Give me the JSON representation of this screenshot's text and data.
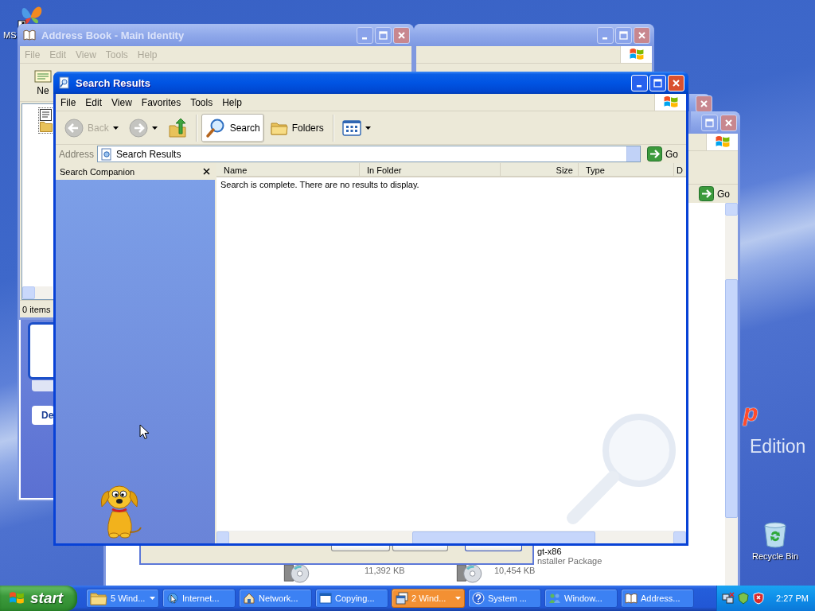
{
  "desktop": {
    "icons": [
      {
        "label": "MS"
      },
      {
        "label": "Recycle Bin"
      }
    ],
    "wallpaper_text": [
      {
        "kind": "logo",
        "text": "p"
      },
      {
        "kind": "caption",
        "text": "Edition"
      }
    ]
  },
  "explorer_behind": {
    "go": "Go",
    "files": [
      {
        "size": "11,392 KB"
      },
      {
        "name": "gt-x86",
        "type": "nstaller Package",
        "size": "10,454 KB"
      }
    ]
  },
  "address_book": {
    "title": "Address Book - Main Identity",
    "active": false,
    "menu": [
      {
        "label": "File",
        "disabled": true
      },
      {
        "label": "Edit",
        "disabled": true
      },
      {
        "label": "View",
        "disabled": true
      },
      {
        "label": "Tools",
        "disabled": true
      },
      {
        "label": "Help",
        "disabled": true
      }
    ],
    "toolbar": [
      {
        "label": "Ne"
      }
    ],
    "status": "0 items"
  },
  "wizard": {
    "button": "De"
  },
  "search_window": {
    "title": "Search Results",
    "active": true,
    "menu": [
      {
        "label": "File",
        "disabled": false
      },
      {
        "label": "Edit",
        "disabled": false
      },
      {
        "label": "View",
        "disabled": false
      },
      {
        "label": "Favorites",
        "disabled": false
      },
      {
        "label": "Tools",
        "disabled": false
      },
      {
        "label": "Help",
        "disabled": false
      }
    ],
    "toolbar": [
      {
        "kind": "back",
        "label": "Back",
        "disabled": true
      },
      {
        "kind": "forward",
        "disabled": true
      },
      {
        "kind": "up"
      },
      {
        "kind": "search",
        "label": "Search",
        "selected": true
      },
      {
        "kind": "folders",
        "label": "Folders",
        "selected": false
      },
      {
        "kind": "views"
      }
    ],
    "address": {
      "label": "Address",
      "value": "Search Results",
      "go": "Go"
    },
    "companion": {
      "title": "Search Companion"
    },
    "columns": [
      "Name",
      "In Folder",
      "Size",
      "Type",
      "D"
    ],
    "message": "Search is complete. There are no results to display."
  },
  "taskbar": {
    "start": "start",
    "items": [
      {
        "label": "5 Wind...",
        "grouped": true,
        "flashing": false
      },
      {
        "label": "Internet...",
        "grouped": false,
        "flashing": false
      },
      {
        "label": "Network...",
        "grouped": false,
        "flashing": false
      },
      {
        "label": "Copying...",
        "grouped": false,
        "flashing": false
      },
      {
        "label": "2 Wind...",
        "grouped": true,
        "flashing": true
      },
      {
        "label": "System ...",
        "grouped": false,
        "flashing": false
      },
      {
        "label": "Window...",
        "grouped": false,
        "flashing": false
      },
      {
        "label": "Address...",
        "grouped": false,
        "flashing": false
      }
    ],
    "clock": "2:27 PM"
  }
}
